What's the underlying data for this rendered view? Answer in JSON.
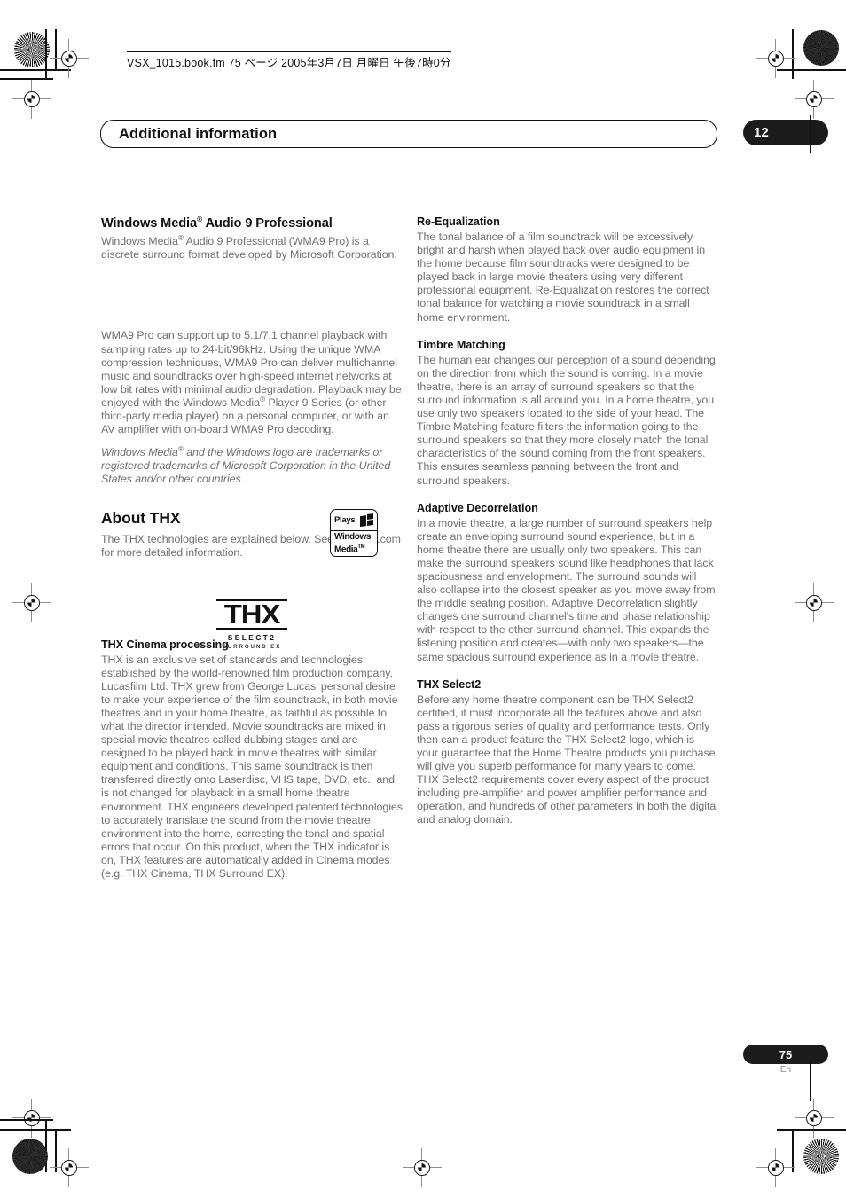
{
  "header": {
    "file_line": "VSX_1015.book.fm 75 ページ 2005年3月7日  月曜日  午後7時0分"
  },
  "title_bar": {
    "title": "Additional information",
    "chapter_number": "12"
  },
  "footer": {
    "page_number": "75",
    "language_code": "En"
  },
  "colors": {
    "badge_background": "#1b1b1b",
    "badge_text": "#ffffff",
    "body_text": "#6f6f6f",
    "heading_text": "#111111"
  },
  "logos": {
    "windows_media": {
      "plays": "Plays",
      "line1": "Windows",
      "line2": "Media",
      "tm": "TM"
    },
    "thx": {
      "word": "THX",
      "line1": "SELECT2",
      "line2": "SURROUND EX"
    }
  },
  "left_column": {
    "heading_wma": {
      "pre": "Windows Media",
      "reg": "®",
      "post": " Audio 9 Professional"
    },
    "p1": {
      "pre": "Windows Media",
      "reg": "®",
      "post": " Audio 9 Professional (WMA9 Pro) is a discrete surround format developed by Microsoft Corporation."
    },
    "p2": {
      "pre": "WMA9 Pro can support up to 5.1/7.1 channel playback with sampling rates up to 24-bit/96kHz. Using the unique WMA compression techniques, WMA9 Pro can deliver multichannel music and soundtracks over high-speed internet networks at low bit rates with minimal audio degradation. Playback may be enjoyed with the Windows Media",
      "reg": "®",
      "post": " Player 9 Series (or other third-party media player) on a personal computer, or with an AV amplifier with on-board WMA9 Pro decoding."
    },
    "p3_italic": {
      "pre": "Windows Media",
      "reg": "®",
      "post": " and the Windows logo are trademarks or registered trademarks of Microsoft Corporation in the United States and/or other countries."
    },
    "heading_thx": "About THX",
    "thx_intro": "The THX technologies are explained below. See www.thx.com for more detailed information.",
    "sub_cinema": {
      "heading": "THX Cinema processing",
      "body": "THX is an exclusive set of standards and technologies established by the world-renowned film production company, Lucasfilm Ltd. THX grew from George Lucas' personal desire to make your experience of the film soundtrack, in both movie theatres and in your home theatre, as faithful as possible to what the director intended. Movie soundtracks are mixed in special movie theatres called dubbing stages and are designed to be played back in movie theatres with similar equipment and conditions. This same soundtrack is then transferred directly onto Laserdisc, VHS tape, DVD, etc., and is not changed for playback in a small home theatre environment. THX engineers developed patented technologies to accurately translate the sound from the movie theatre environment into the home, correcting the tonal and spatial errors that occur. On this product, when the THX indicator is on, THX features are automatically added in Cinema modes (e.g. THX Cinema, THX Surround EX)."
    }
  },
  "right_column": {
    "sub_reeq": {
      "heading": "Re-Equalization",
      "body": "The tonal balance of a film soundtrack will be excessively bright and harsh when played back over audio equipment in the home because film soundtracks were designed to be played back in large movie theaters using very different professional equipment. Re-Equalization restores the correct tonal balance for watching a movie soundtrack in a small home environment."
    },
    "sub_timbre": {
      "heading": "Timbre Matching",
      "body": "The human ear changes our perception of a sound depending on the direction from which the sound is coming. In a movie theatre, there is an array of surround speakers so that the surround information is all around you. In a home theatre, you use only two speakers located to the side of your head. The Timbre Matching feature filters the information going to the surround speakers so that they more closely match the tonal characteristics of the sound coming from the front speakers. This ensures seamless panning between the front and surround speakers."
    },
    "sub_adaptive": {
      "heading": "Adaptive Decorrelation",
      "body": "In a movie theatre, a large number of surround speakers help create an enveloping surround sound experience, but in a home theatre there are usually only two speakers. This can make the surround speakers sound like headphones that lack spaciousness and envelopment. The surround sounds will also collapse into the closest speaker as you move away from the middle seating position. Adaptive Decorrelation slightly changes one surround channel's time and phase relationship with respect to the other surround channel. This expands the listening position and creates—with only two speakers—the same spacious surround experience as in a movie theatre."
    },
    "sub_select2": {
      "heading": "THX Select2",
      "body": "Before any home theatre component can be THX Select2 certified, it must incorporate all the features above and also pass a rigorous series of quality and performance tests. Only then can a product feature the THX Select2 logo, which is your guarantee that the Home Theatre products you purchase will give you superb performance for many years to come. THX Select2 requirements cover every aspect of the product including pre-amplifier and power amplifier performance and operation, and hundreds of other parameters in both the digital and analog domain."
    }
  }
}
